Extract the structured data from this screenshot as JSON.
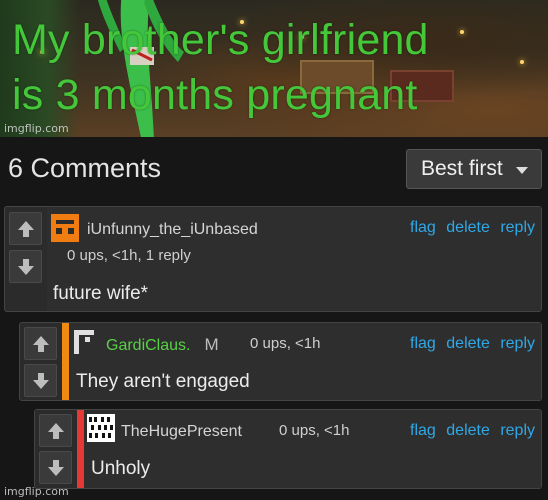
{
  "meme": {
    "caption_line1": "My brother's girlfriend",
    "caption_line2": "is 3 months pregnant",
    "watermark": "imgflip.com"
  },
  "comments_header": {
    "count_label": "6 Comments",
    "sort_value": "Best first"
  },
  "comments": [
    {
      "username": "iUnfunny_the_iUnbased",
      "meta": "0 ups, <1h, 1 reply",
      "text": "future wife*",
      "actions": {
        "flag": "flag",
        "delete": "delete",
        "reply": "reply"
      },
      "accent_color": "",
      "avatar_color": "#f07c12"
    },
    {
      "username": "GardiClaus.",
      "badge": "M",
      "meta": "0 ups, <1h",
      "text": "They aren't engaged",
      "actions": {
        "flag": "flag",
        "delete": "delete",
        "reply": "reply"
      },
      "accent_color": "#f08a10",
      "username_color": "#58d046"
    },
    {
      "username": "TheHugePresent",
      "meta": "0 ups, <1h",
      "text": "Unholy",
      "actions": {
        "flag": "flag",
        "delete": "delete",
        "reply": "reply"
      },
      "accent_color": "#e53935"
    }
  ],
  "footer": {
    "watermark": "imgflip.com"
  }
}
